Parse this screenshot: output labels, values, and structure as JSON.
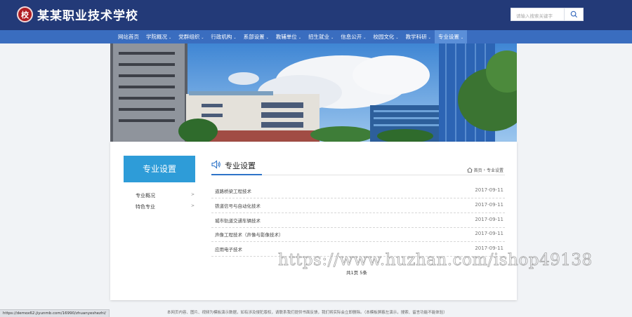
{
  "header": {
    "school_name": "某某职业技术学校",
    "logo_icon": "school-seal-icon",
    "search_placeholder": "请输入搜索关键字",
    "search_icon": "search-icon",
    "colors": {
      "header_bg": "#233a78",
      "nav_bg": "#3a6dbf",
      "accent": "#2e9cd8"
    }
  },
  "nav": {
    "items": [
      {
        "label": "网站首页",
        "dropdown": false
      },
      {
        "label": "学院概况",
        "dropdown": true
      },
      {
        "label": "党群组织",
        "dropdown": true
      },
      {
        "label": "行政机构",
        "dropdown": true
      },
      {
        "label": "系部设置",
        "dropdown": true
      },
      {
        "label": "教辅单位",
        "dropdown": true
      },
      {
        "label": "招生就业",
        "dropdown": true
      },
      {
        "label": "信息公开",
        "dropdown": true
      },
      {
        "label": "校园文化",
        "dropdown": true
      },
      {
        "label": "教学科研",
        "dropdown": true
      },
      {
        "label": "专业设置",
        "dropdown": true,
        "active": true
      }
    ]
  },
  "sidebar": {
    "title": "专业设置",
    "items": [
      {
        "label": "专业概况"
      },
      {
        "label": "特色专业"
      }
    ]
  },
  "section": {
    "title": "专业设置",
    "icon": "speaker-icon",
    "breadcrumb": {
      "home_icon": "home-icon",
      "home": "首页",
      "sep": "›",
      "current": "专业设置"
    }
  },
  "list": [
    {
      "title": "道路桥梁工程技术",
      "date": "2017-09-11"
    },
    {
      "title": "铁道信号与自动化技术",
      "date": "2017-09-11"
    },
    {
      "title": "城市轨道交通车辆技术",
      "date": "2017-09-11"
    },
    {
      "title": "声像工程技术（声像与影像技术）",
      "date": "2017-09-11"
    },
    {
      "title": "应用电子技术",
      "date": "2017-09-11"
    }
  ],
  "pager": "共1页 5条",
  "watermark": "https://www.huzhan.com/ishop49138",
  "footer": "本网页内容、图片、视频为模板演示数据，如有涉及侵犯版权，请联系我们提供书面反馈，我们将实际会立即删除。（本模板屏蔽左演示，搜索、留言功能不能体验）",
  "status_url": "https://demox62.jiyunmb.com/16990/zhuanyeshezhi/"
}
